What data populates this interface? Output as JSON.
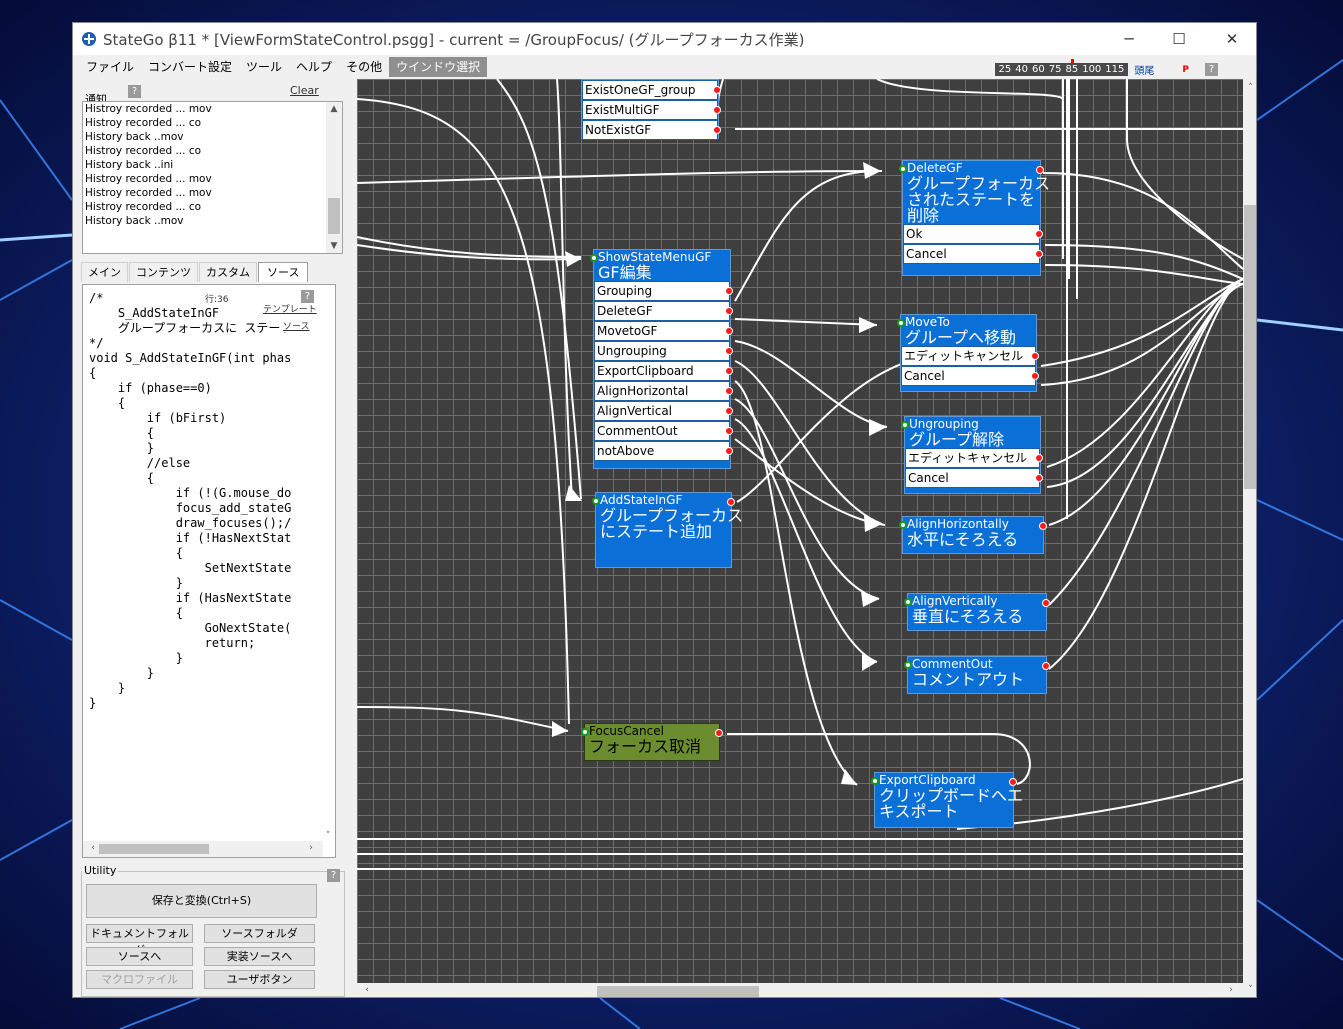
{
  "window": {
    "title": "StateGo β11 *  [ViewFormStateControl.psgg] - current = /GroupFocus/ (グループフォーカス作業)",
    "minimize": "─",
    "maximize": "☐",
    "close": "✕"
  },
  "menu": [
    "ファイル",
    "コンバート設定",
    "ツール",
    "ヘルプ",
    "その他",
    "ウインドウ選択"
  ],
  "zoom": {
    "levels": [
      "25",
      "40",
      "60",
      "75",
      "85",
      "100",
      "115"
    ],
    "current": "85",
    "head_label": "頭尾",
    "p_label": "P"
  },
  "help": "?",
  "notice": {
    "label": "通知",
    "clear": "Clear",
    "lines": [
      "Histroy recorded ... mov",
      "Histroy recorded ... co",
      "History back ..mov",
      "Histroy recorded ... co",
      "History back ..ini",
      "Histroy recorded ... mov",
      "Histroy recorded ... mov",
      "Histroy recorded ... co",
      "History back ..mov"
    ]
  },
  "tabs": [
    "メイン",
    "コンテンツ",
    "カスタム",
    "ソース"
  ],
  "source": {
    "line_info": "行:36",
    "template_link": "テンプレート",
    "source_link": "ソース",
    "code": "/*\n    S_AddStateInGF\n    グループフォーカスに ステート\n*/\nvoid S_AddStateInGF(int phas\n{\n    if (phase==0)\n    {\n        if (bFirst)\n        {\n        }\n        //else\n        {\n            if (!(G.mouse_do\n            focus_add_stateG\n            draw_focuses();/\n            if (!HasNextStat\n            {\n                SetNextState\n            }\n            if (HasNextState\n            {\n                GoNextState(\n                return;\n            }\n        }\n    }\n}"
  },
  "utility": {
    "label": "Utility",
    "save": "保存と変換(Ctrl+S)",
    "doc_folder": "ドキュメントフォルダ",
    "src_folder": "ソースフォルダ",
    "to_source": "ソースへ",
    "impl_source": "実装ソースへ",
    "macro_file": "マクロファイル",
    "user_button": "ユーザボタン"
  },
  "nodes": {
    "top": {
      "rows": [
        "ExistOneGF_group",
        "ExistMultiGF",
        "NotExistGF"
      ]
    },
    "showmenu": {
      "title": "ShowStateMenuGF",
      "jp": "GF編集",
      "rows": [
        "Grouping",
        "DeleteGF",
        "MovetoGF",
        "Ungrouping",
        "ExportClipboard",
        "AlignHorizontal",
        "AlignVertical",
        "CommentOut",
        "notAbove"
      ]
    },
    "addstate": {
      "title": "AddStateInGF",
      "jp": "グループフォーカス\nにステート追加"
    },
    "deletegf": {
      "title": "DeleteGF",
      "jp": "グループフォーカス\nされたステートを\n削除",
      "rows": [
        "Ok",
        "Cancel"
      ]
    },
    "moveto": {
      "title": "MoveTo",
      "jp": "グループへ移動",
      "rows": [
        "エディットキャンセル",
        "Cancel"
      ]
    },
    "ungrouping": {
      "title": "Ungrouping",
      "jp": "グループ解除",
      "rows": [
        "エディットキャンセル",
        "Cancel"
      ]
    },
    "alignh": {
      "title": "AlignHorizontally",
      "jp": "水平にそろえる"
    },
    "alignv": {
      "title": "AlignVertically",
      "jp": "垂直にそろえる"
    },
    "comment": {
      "title": "CommentOut",
      "jp": "コメントアウト"
    },
    "focuscancel": {
      "title": "FocusCancel",
      "jp": "フォーカス取消"
    },
    "export": {
      "title": "ExportClipboard",
      "jp": "クリップボードへエ\nキスポート"
    }
  },
  "colors": {
    "node": "#0a6fd6",
    "node_green": "#6b8c2f",
    "canvas": "#3f3f3f",
    "grid": "#6e6e6e"
  }
}
